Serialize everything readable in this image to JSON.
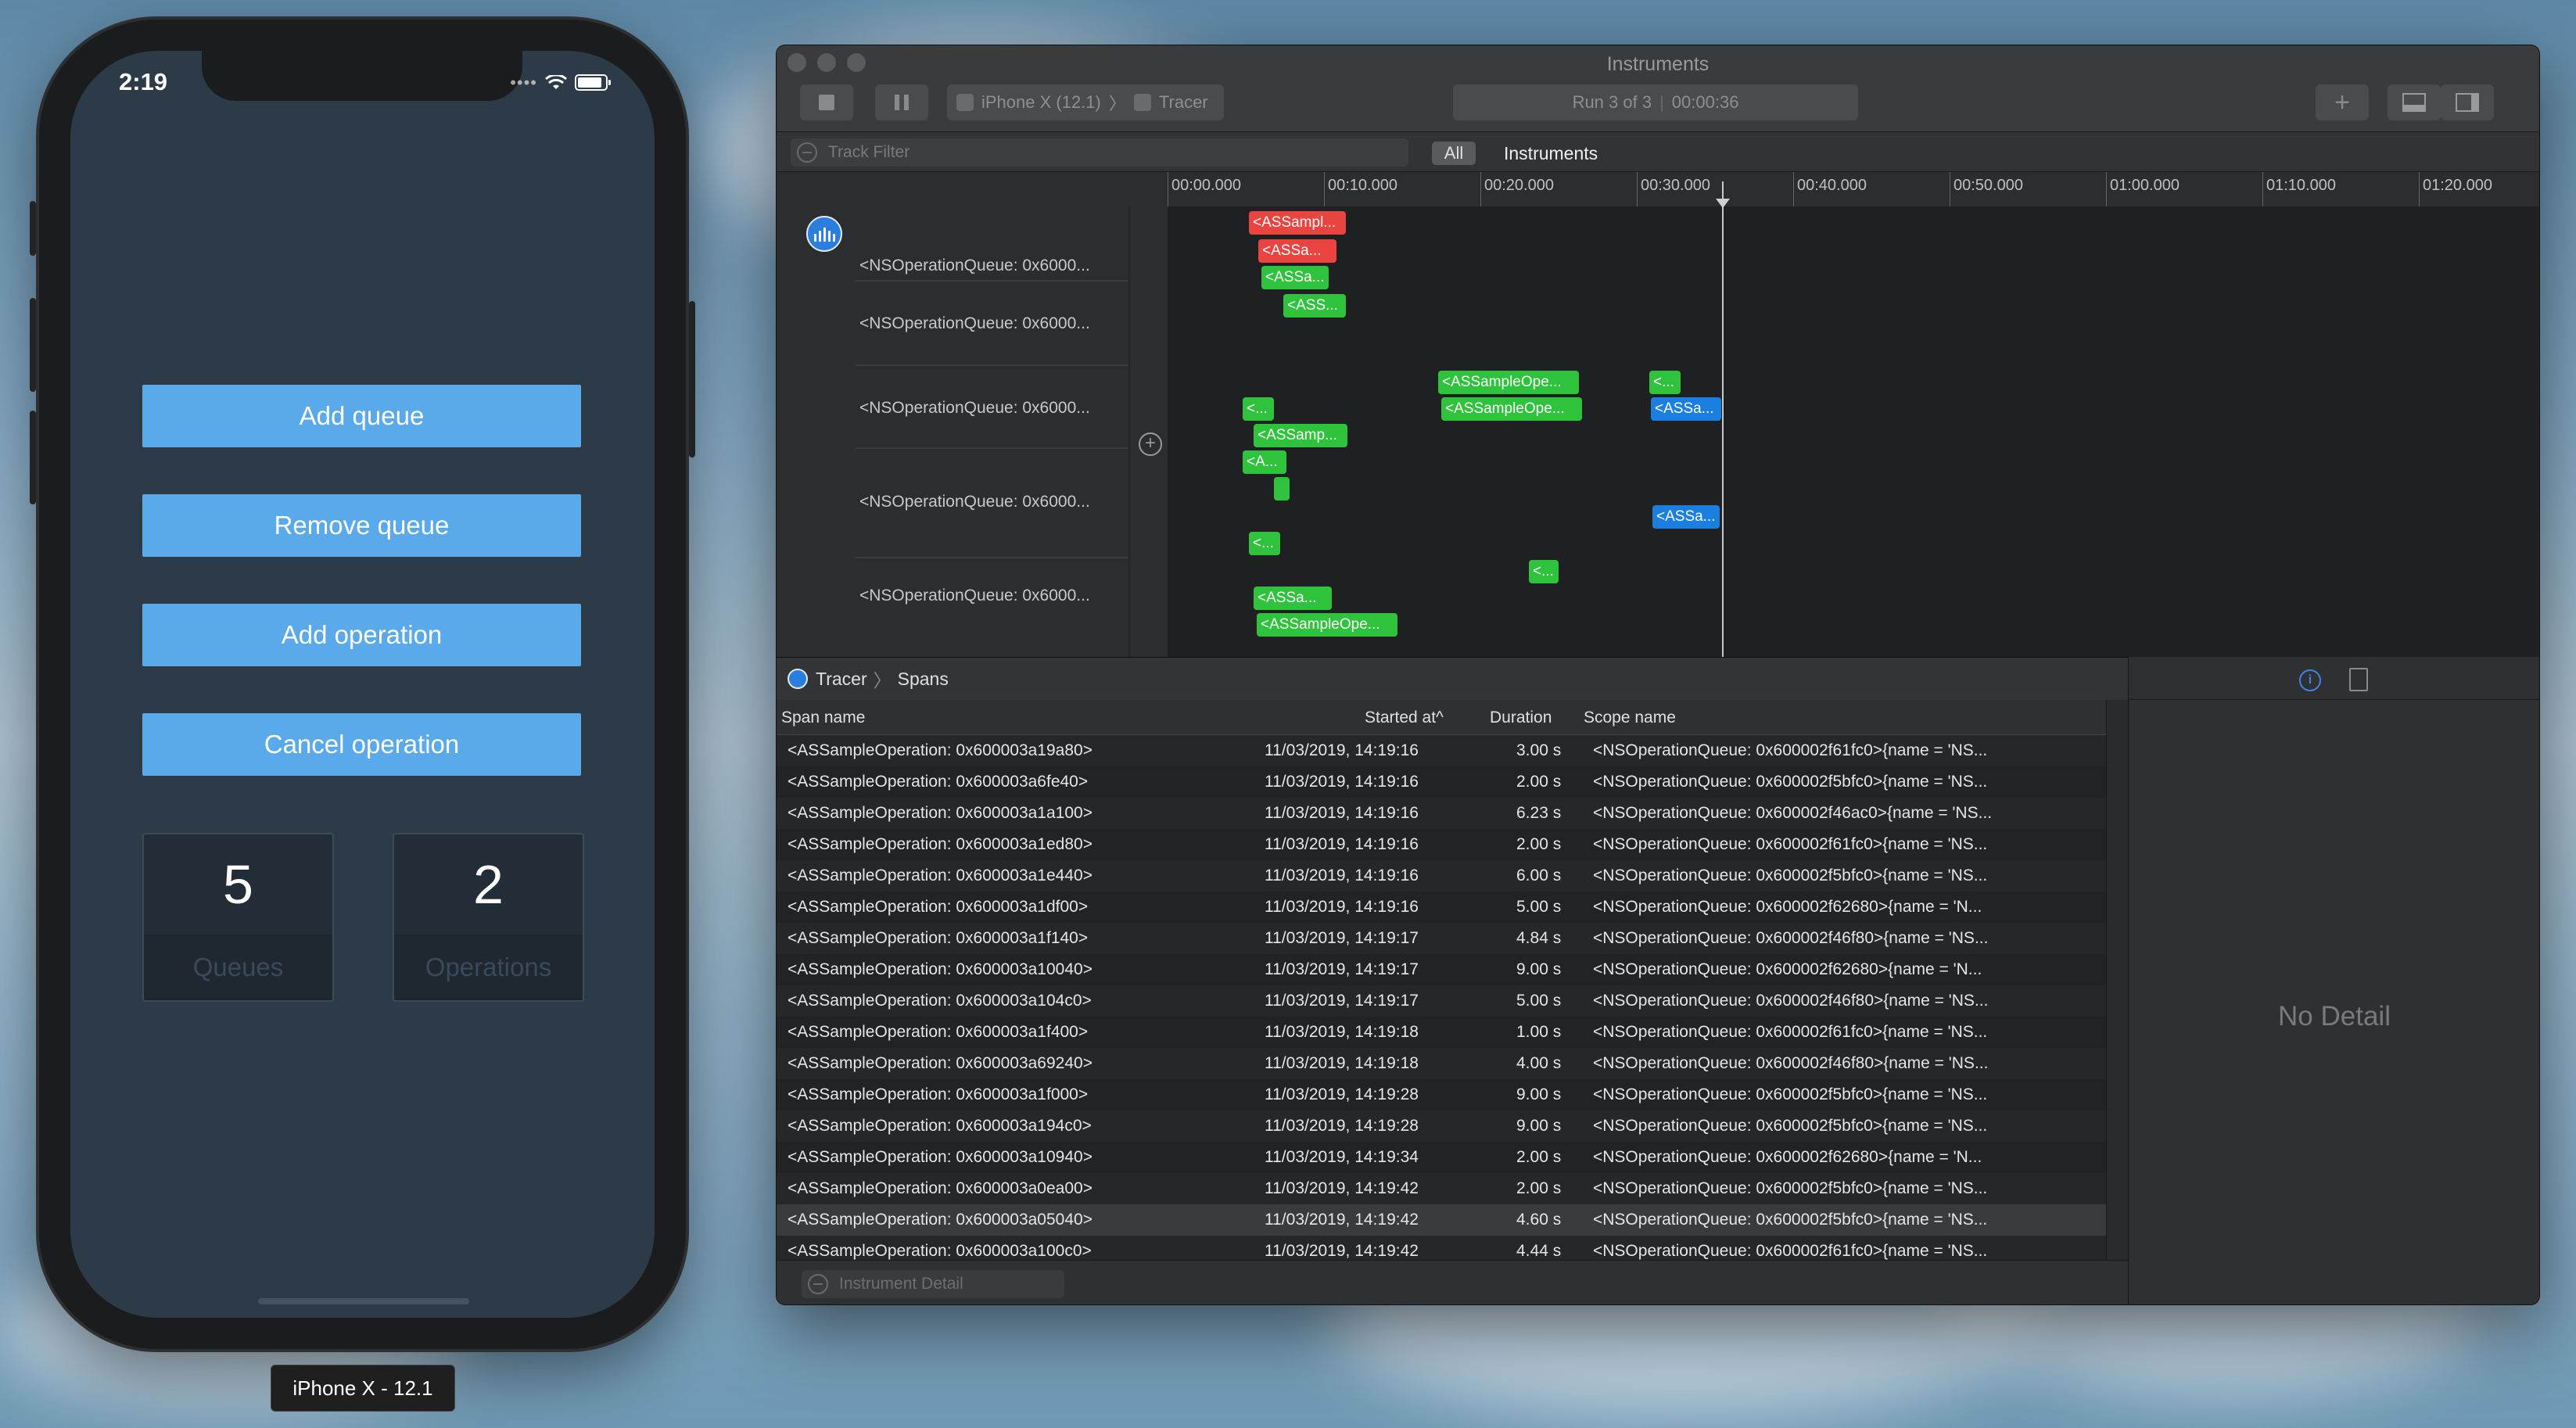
{
  "phone": {
    "time": "2:19",
    "buttons": [
      "Add queue",
      "Remove queue",
      "Add operation",
      "Cancel operation"
    ],
    "queues_value": "5",
    "queues_label": "Queues",
    "operations_value": "2",
    "operations_label": "Operations",
    "device_label": "iPhone X - 12.1"
  },
  "window": {
    "title": "Instruments",
    "device": "iPhone X (12.1)",
    "template": "Tracer",
    "run": "Run 3 of 3",
    "elapsed": "00:00:36",
    "track_filter_placeholder": "Track Filter",
    "segment_all": "All",
    "segment_instruments": "Instruments",
    "ticks": [
      "00:00.000",
      "00:10.000",
      "00:20.000",
      "00:30.000",
      "00:40.000",
      "00:50.000",
      "01:00.000",
      "01:10.000",
      "01:20.000"
    ],
    "tracks": [
      "<NSOperationQueue: 0x6000...",
      "<NSOperationQueue: 0x6000...",
      "<NSOperationQueue: 0x6000...",
      "<NSOperationQueue: 0x6000...",
      "<NSOperationQueue: 0x6000..."
    ],
    "span_labels": {
      "s1": "<ASSampl...",
      "s2": "<ASSa...",
      "s3": "<ASSa...",
      "s4": "<ASS...",
      "s5": "<ASSampleOpe...",
      "s6": "<...",
      "s7": "<ASSampleOpe...",
      "s8": "<...",
      "s9": "<ASSa...",
      "s10": "<ASSamp...",
      "s11": "<A...",
      "s12": "",
      "s13": "<ASSa...",
      "s14": "<...",
      "s15": "<...",
      "s16": "<ASSa...",
      "s17": "<ASSampleOpe..."
    },
    "breadcrumb_root": "Tracer",
    "breadcrumb_child": "Spans",
    "columns": {
      "span": "Span name",
      "started": "Started at^",
      "duration": "Duration",
      "scope": "Scope name"
    },
    "rows": [
      {
        "name": "<ASSampleOperation: 0x600003a19a80>",
        "started": "11/03/2019, 14:19:16",
        "duration": "3.00 s",
        "scope": "<NSOperationQueue: 0x600002f61fc0>{name = 'NS..."
      },
      {
        "name": "<ASSampleOperation: 0x600003a6fe40>",
        "started": "11/03/2019, 14:19:16",
        "duration": "2.00 s",
        "scope": "<NSOperationQueue: 0x600002f5bfc0>{name = 'NS..."
      },
      {
        "name": "<ASSampleOperation: 0x600003a1a100>",
        "started": "11/03/2019, 14:19:16",
        "duration": "6.23 s",
        "scope": "<NSOperationQueue: 0x600002f46ac0>{name = 'NS..."
      },
      {
        "name": "<ASSampleOperation: 0x600003a1ed80>",
        "started": "11/03/2019, 14:19:16",
        "duration": "2.00 s",
        "scope": "<NSOperationQueue: 0x600002f61fc0>{name = 'NS..."
      },
      {
        "name": "<ASSampleOperation: 0x600003a1e440>",
        "started": "11/03/2019, 14:19:16",
        "duration": "6.00 s",
        "scope": "<NSOperationQueue: 0x600002f5bfc0>{name = 'NS..."
      },
      {
        "name": "<ASSampleOperation: 0x600003a1df00>",
        "started": "11/03/2019, 14:19:16",
        "duration": "5.00 s",
        "scope": "<NSOperationQueue: 0x600002f62680>{name = 'N..."
      },
      {
        "name": "<ASSampleOperation: 0x600003a1f140>",
        "started": "11/03/2019, 14:19:17",
        "duration": "4.84 s",
        "scope": "<NSOperationQueue: 0x600002f46f80>{name = 'NS..."
      },
      {
        "name": "<ASSampleOperation: 0x600003a10040>",
        "started": "11/03/2019, 14:19:17",
        "duration": "9.00 s",
        "scope": "<NSOperationQueue: 0x600002f62680>{name = 'N..."
      },
      {
        "name": "<ASSampleOperation: 0x600003a104c0>",
        "started": "11/03/2019, 14:19:17",
        "duration": "5.00 s",
        "scope": "<NSOperationQueue: 0x600002f46f80>{name = 'NS..."
      },
      {
        "name": "<ASSampleOperation: 0x600003a1f400>",
        "started": "11/03/2019, 14:19:18",
        "duration": "1.00 s",
        "scope": "<NSOperationQueue: 0x600002f61fc0>{name = 'NS..."
      },
      {
        "name": "<ASSampleOperation: 0x600003a69240>",
        "started": "11/03/2019, 14:19:18",
        "duration": "4.00 s",
        "scope": "<NSOperationQueue: 0x600002f46f80>{name = 'NS..."
      },
      {
        "name": "<ASSampleOperation: 0x600003a1f000>",
        "started": "11/03/2019, 14:19:28",
        "duration": "9.00 s",
        "scope": "<NSOperationQueue: 0x600002f5bfc0>{name = 'NS..."
      },
      {
        "name": "<ASSampleOperation: 0x600003a194c0>",
        "started": "11/03/2019, 14:19:28",
        "duration": "9.00 s",
        "scope": "<NSOperationQueue: 0x600002f5bfc0>{name = 'NS..."
      },
      {
        "name": "<ASSampleOperation: 0x600003a10940>",
        "started": "11/03/2019, 14:19:34",
        "duration": "2.00 s",
        "scope": "<NSOperationQueue: 0x600002f62680>{name = 'N..."
      },
      {
        "name": "<ASSampleOperation: 0x600003a0ea00>",
        "started": "11/03/2019, 14:19:42",
        "duration": "2.00 s",
        "scope": "<NSOperationQueue: 0x600002f5bfc0>{name = 'NS..."
      },
      {
        "name": "<ASSampleOperation: 0x600003a05040>",
        "started": "11/03/2019, 14:19:42",
        "duration": "4.60 s",
        "scope": "<NSOperationQueue: 0x600002f5bfc0>{name = 'NS..."
      },
      {
        "name": "<ASSampleOperation: 0x600003a100c0>",
        "started": "11/03/2019, 14:19:42",
        "duration": "4.44 s",
        "scope": "<NSOperationQueue: 0x600002f61fc0>{name = 'NS..."
      }
    ],
    "selected_row": 15,
    "instrument_detail_placeholder": "Instrument Detail",
    "inspector_empty": "No Detail"
  },
  "colors": {
    "accent_button": "#5aa9ea",
    "span_red": "#e94440",
    "span_green": "#2fc23d",
    "span_blue": "#1a7fe0"
  }
}
